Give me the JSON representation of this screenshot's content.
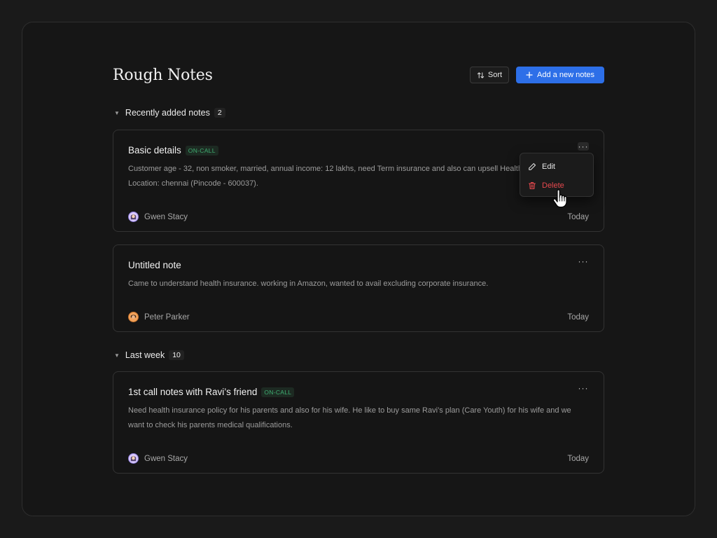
{
  "page": {
    "title": "Rough Notes",
    "sort_label": "Sort",
    "add_label": "Add a new notes"
  },
  "sections": [
    {
      "label": "Recently added notes",
      "count": "2",
      "notes": [
        {
          "title": "Basic details",
          "tag": "ON-CALL",
          "body": "Customer age - 32, non smoker, married, annual income: 12 lakhs, need Term insurance and also can upsell Health. Location: chennai (Pincode - 600037).",
          "author": "Gwen Stacy",
          "date": "Today"
        },
        {
          "title": "Untitled note",
          "tag": "",
          "body": "Came to understand health insurance. working in Amazon, wanted to avail excluding corporate insurance.",
          "author": "Peter Parker",
          "date": "Today"
        }
      ]
    },
    {
      "label": "Last week",
      "count": "10",
      "notes": [
        {
          "title": "1st call notes with Ravi’s friend",
          "tag": "ON-CALL",
          "body": "Need health insurance policy for his parents and also for his wife. He like to buy same Ravi’s plan (Care Youth) for his wife and we want to check his parents medical qualifications.",
          "author": "Gwen Stacy",
          "date": "Today"
        }
      ]
    }
  ],
  "context_menu": {
    "edit_label": "Edit",
    "delete_label": "Delete"
  },
  "colors": {
    "accent": "#2d6fe8",
    "tag_green": "#3fae72",
    "danger": "#e5484d"
  },
  "icons": {
    "sort": "sort-arrows-icon",
    "add": "plus-icon",
    "more": "more-horizontal-icon",
    "edit": "pencil-icon",
    "delete": "trash-icon",
    "caret": "caret-down-icon",
    "cursor": "hand-pointer-icon"
  }
}
